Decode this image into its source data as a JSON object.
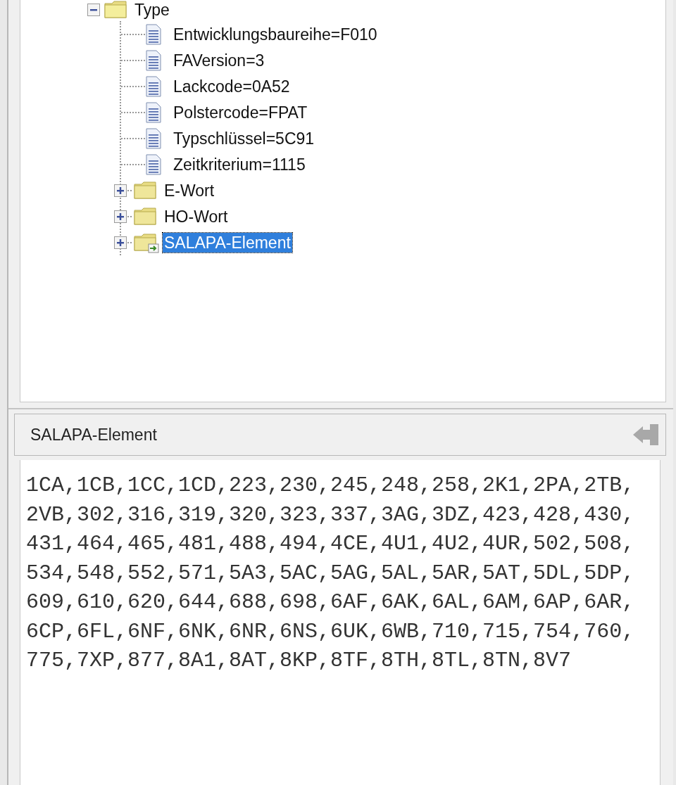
{
  "tree": {
    "label": "Type",
    "kind": "folder",
    "expanded": true,
    "selected": false,
    "children": [
      {
        "label": "Entwicklungsbaureihe=F010",
        "kind": "leaf",
        "selected": false
      },
      {
        "label": "FAVersion=3",
        "kind": "leaf",
        "selected": false
      },
      {
        "label": "Lackcode=0A52",
        "kind": "leaf",
        "selected": false
      },
      {
        "label": "Polstercode=FPAT",
        "kind": "leaf",
        "selected": false
      },
      {
        "label": "Typschlüssel=5C91",
        "kind": "leaf",
        "selected": false
      },
      {
        "label": "Zeitkriterium=1115",
        "kind": "leaf",
        "selected": false
      },
      {
        "label": "E-Wort",
        "kind": "folder",
        "expanded": false,
        "selected": false
      },
      {
        "label": "HO-Wort",
        "kind": "folder",
        "expanded": false,
        "selected": false
      },
      {
        "label": "SALAPA-Element",
        "kind": "linked-folder",
        "expanded": false,
        "selected": true
      }
    ]
  },
  "detail_panel": {
    "title": "SALAPA-Element",
    "lines": [
      "1CA,1CB,1CC,1CD,223,230,245,248,258,2K1,2PA,2TB,",
      "2VB,302,316,319,320,323,337,3AG,3DZ,423,428,430,",
      "431,464,465,481,488,494,4CE,4U1,4U2,4UR,502,508,",
      "534,548,552,571,5A3,5AC,5AG,5AL,5AR,5AT,5DL,5DP,",
      "609,610,620,644,688,698,6AF,6AK,6AL,6AM,6AP,6AR,",
      "6CP,6FL,6NF,6NK,6NR,6NS,6UK,6WB,710,715,754,760,",
      "775,7XP,877,8A1,8AT,8KP,8TF,8TH,8TL,8TN,8V7"
    ]
  }
}
